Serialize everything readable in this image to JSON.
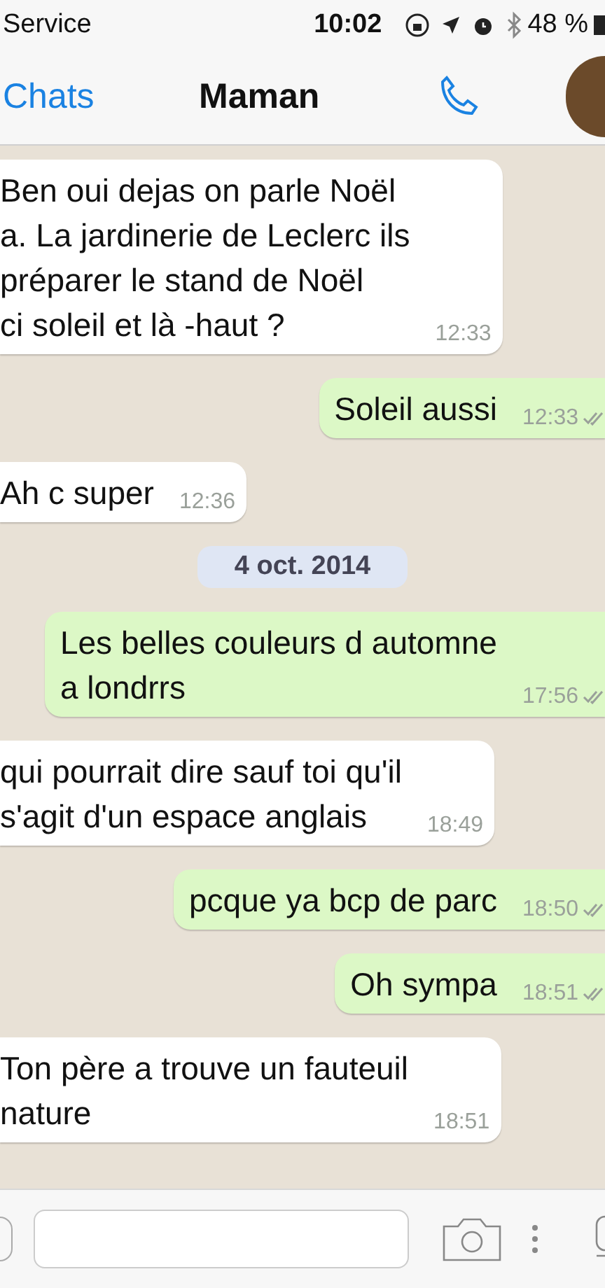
{
  "status_bar": {
    "carrier": "Service",
    "time": "10:02",
    "battery": "48 %"
  },
  "nav": {
    "back": "Chats",
    "title": "Maman"
  },
  "messages": [
    {
      "kind": "received",
      "text": "Ben oui dejas on parle Noël\na. La jardinerie de Leclerc ils\npréparer le stand de Noël\nci soleil et là -haut ?",
      "time": "12:33"
    },
    {
      "kind": "sent",
      "text": "Soleil aussi",
      "time": "12:33"
    },
    {
      "kind": "received",
      "text": "Ah c super",
      "time": "12:36"
    },
    {
      "kind": "date",
      "text": "4 oct. 2014"
    },
    {
      "kind": "sent",
      "text": "Les belles couleurs d automne\na londrrs",
      "time": "17:56"
    },
    {
      "kind": "received",
      "text": "qui pourrait dire sauf toi qu'il\ns'agit d'un espace anglais",
      "time": "18:49"
    },
    {
      "kind": "sent",
      "text": "pcque ya bcp de parc",
      "time": "18:50"
    },
    {
      "kind": "sent",
      "text": "Oh sympa",
      "time": "18:51"
    },
    {
      "kind": "received",
      "text": "Ton père a trouve un fauteuil\nnature",
      "time": "18:51"
    }
  ]
}
